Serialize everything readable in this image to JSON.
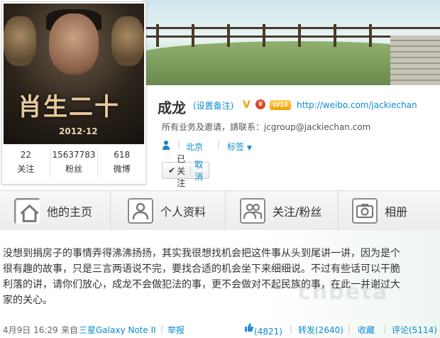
{
  "avatar": {
    "poster_title": "十二生肖",
    "poster_title_display": "肖生二十",
    "poster_date": "2012·12"
  },
  "stats": [
    {
      "count": "22",
      "label": "关注"
    },
    {
      "count": "15637783",
      "label": "粉丝"
    },
    {
      "count": "618",
      "label": "微博"
    }
  ],
  "profile": {
    "name": "成龙",
    "remark": "(设置备注)",
    "verified": "V",
    "level": "LV13",
    "url": "http://weibo.com/jackiechan",
    "business": "所有业务及邀请，請联系：jcgroup@jackiechan.com",
    "location": "北京",
    "tags_label": "标签",
    "followed_label": "已关注",
    "cancel_label": "取消"
  },
  "nav": [
    {
      "label": "他的主页",
      "icon": "home-icon"
    },
    {
      "label": "个人资料",
      "icon": "profile-icon"
    },
    {
      "label": "关注/粉丝",
      "icon": "followers-icon"
    },
    {
      "label": "相册",
      "icon": "camera-icon"
    }
  ],
  "post": {
    "line1": "没想到捐房子的事情弄得沸沸扬扬，其实我很想找机会把这件事从头到尾讲一讲，因为是个",
    "line2": "很有趣的故事，只是三言两语说不完，要找合适的机会坐下来细细说。不过有些话可以干脆",
    "line3": "利落的讲，请你们放心，成龙不会做犯法的事，更不会做对不起民族的事，在此一并谢过大",
    "line4": "家的关心。",
    "date": "4月9日 16:29",
    "source_prefix": "来自",
    "source": "三星Galaxy Note II",
    "report": "举报",
    "likes": "(4821)",
    "repost": "转发(2640)",
    "favorite": "收藏",
    "comment": "评论(5114)"
  },
  "colors": {
    "link": "#0a8cd2",
    "text": "#333333"
  }
}
